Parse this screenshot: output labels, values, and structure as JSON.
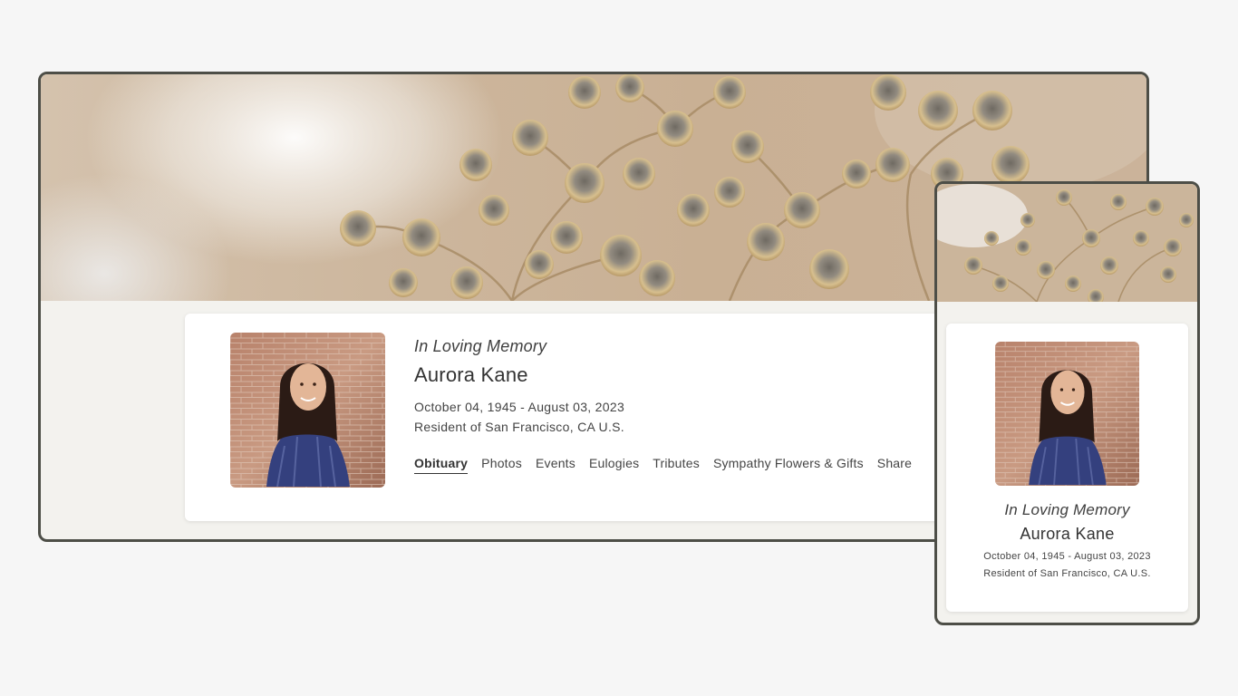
{
  "desktop": {
    "memorial": {
      "kicker": "In Loving Memory",
      "name": "Aurora Kane",
      "dates": "October 04, 1945 - August 03, 2023",
      "residence": "Resident of San Francisco, CA U.S."
    },
    "tabs": [
      {
        "label": "Obituary",
        "active": true
      },
      {
        "label": "Photos",
        "active": false
      },
      {
        "label": "Events",
        "active": false
      },
      {
        "label": "Eulogies",
        "active": false
      },
      {
        "label": "Tributes",
        "active": false
      },
      {
        "label": "Sympathy Flowers & Gifts",
        "active": false
      },
      {
        "label": "Share",
        "active": false
      }
    ]
  },
  "mobile": {
    "memorial": {
      "kicker": "In Loving Memory",
      "name": "Aurora Kane",
      "dates": "October 04, 1945 - August 03, 2023",
      "residence": "Resident of San Francisco, CA U.S."
    }
  },
  "colors": {
    "frame": "#4d4e47",
    "page_bg": "#f6f6f6",
    "content_bg": "#f3f2ee",
    "card_bg": "#ffffff",
    "text": "#3a3a3a",
    "banner_tone": "#cdb9a2"
  },
  "images": {
    "banner": "dried-flower-banner-image",
    "portrait": "portrait-photo-image"
  }
}
